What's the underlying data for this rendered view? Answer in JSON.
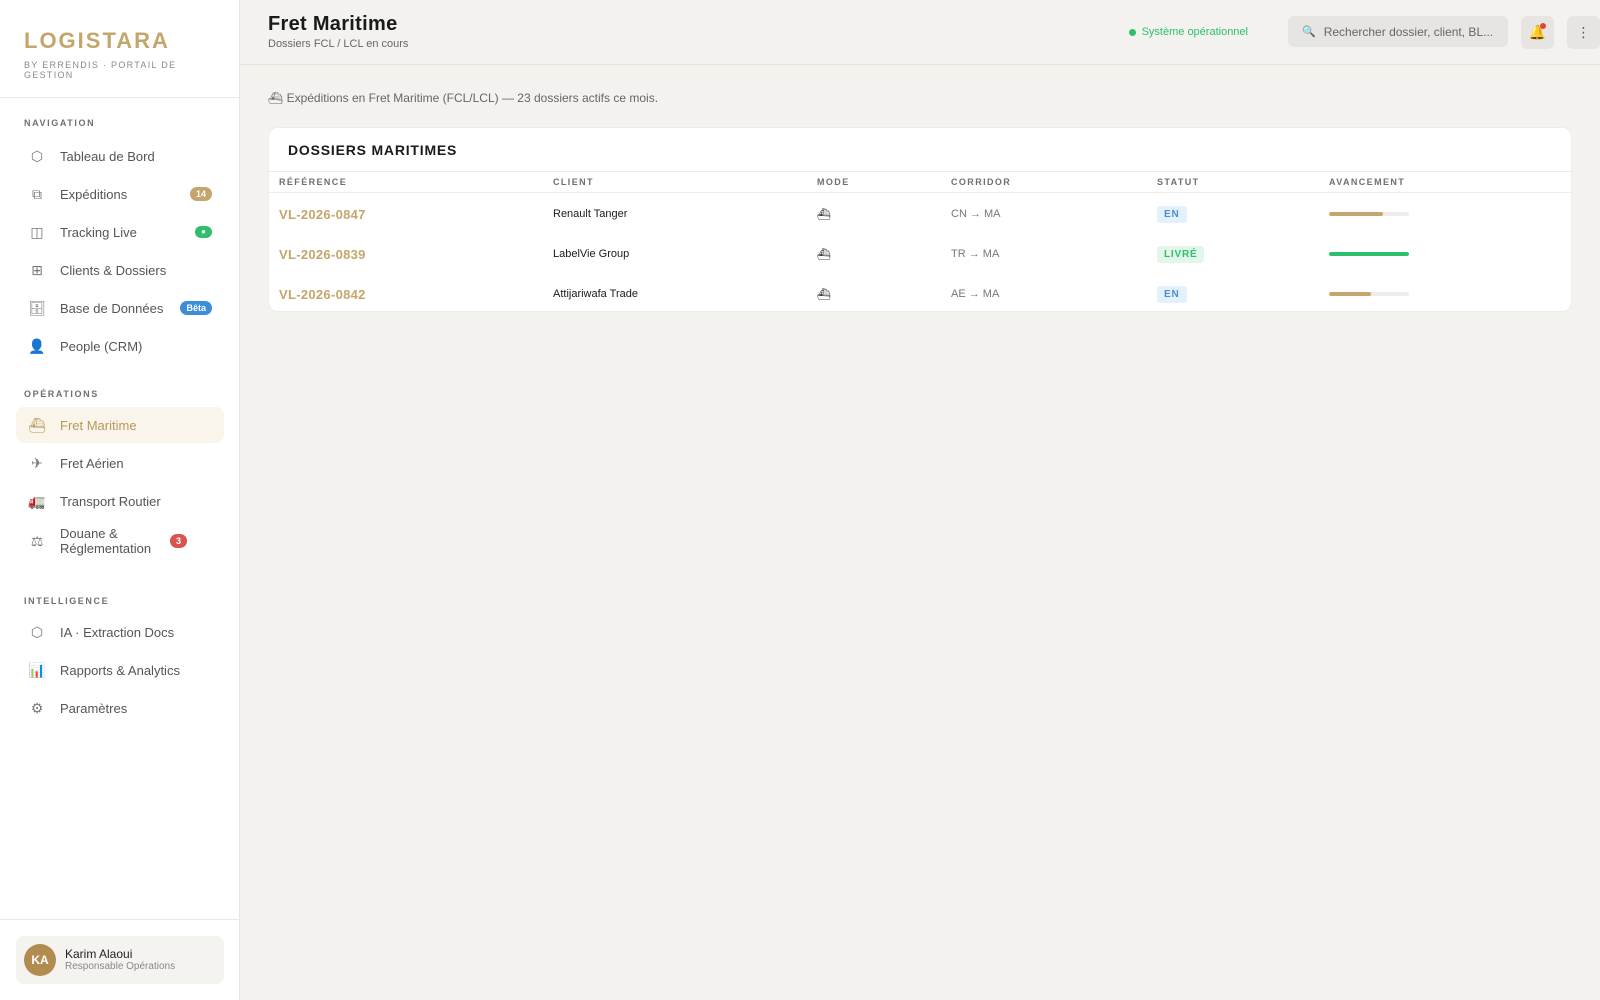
{
  "brand": {
    "name": "LOGISTARA",
    "subtitle": "BY ERRENDIS · PORTAIL DE GESTION"
  },
  "sidebar": {
    "sections": [
      {
        "title": "NAVIGATION",
        "items": [
          {
            "label": "Tableau de Bord",
            "icon": "dashboard-icon"
          },
          {
            "label": "Expéditions",
            "icon": "shipments-icon",
            "badge": "14"
          },
          {
            "label": "Tracking Live",
            "icon": "tracking-icon",
            "badge": "●"
          },
          {
            "label": "Clients & Dossiers",
            "icon": "clients-icon"
          },
          {
            "label": "Base de Données",
            "icon": "database-icon",
            "badge": "Bêta"
          },
          {
            "label": "People (CRM)",
            "icon": "people-icon"
          }
        ]
      },
      {
        "title": "OPÉRATIONS",
        "items": [
          {
            "label": "Fret Maritime",
            "icon": "ship-icon",
            "active": true
          },
          {
            "label": "Fret Aérien",
            "icon": "plane-icon"
          },
          {
            "label": "Transport Routier",
            "icon": "truck-icon"
          },
          {
            "label": "Douane & Réglementation",
            "icon": "scale-icon",
            "badge": "3"
          }
        ]
      },
      {
        "title": "INTELLIGENCE",
        "items": [
          {
            "label": "IA · Extraction Docs",
            "icon": "ai-icon"
          },
          {
            "label": "Rapports & Analytics",
            "icon": "chart-icon"
          },
          {
            "label": "Paramètres",
            "icon": "gear-icon"
          }
        ]
      }
    ],
    "user": {
      "initials": "KA",
      "name": "Karim Alaoui",
      "role": "Responsable Opérations"
    }
  },
  "header": {
    "title": "Fret Maritime",
    "subtitle": "Dossiers FCL / LCL en cours",
    "status": "Système opérationnel",
    "search_placeholder": "Rechercher dossier, client, BL..."
  },
  "main": {
    "intro": "⛴ Expéditions en Fret Maritime (FCL/LCL) — 23 dossiers actifs ce mois.",
    "card_title": "DOSSIERS MARITIMES",
    "columns": [
      "RÉFÉRENCE",
      "CLIENT",
      "MODE",
      "CORRIDOR",
      "STATUT",
      "AVANCEMENT"
    ],
    "rows": [
      {
        "ref": "VL-2026-0847",
        "client": "Renault Tanger",
        "mode": "⛴",
        "corridor": "CN → MA",
        "status": "EN",
        "progress": 0.68
      },
      {
        "ref": "VL-2026-0839",
        "client": "LabelVie Group",
        "mode": "⛴",
        "corridor": "TR → MA",
        "status": "LIVRÉ",
        "progress": 1.0
      },
      {
        "ref": "VL-2026-0842",
        "client": "Attijariwafa Trade",
        "mode": "⛴",
        "corridor": "AE → MA",
        "status": "EN",
        "progress": 0.53
      }
    ]
  },
  "colors": {
    "accent": "#c4a56b",
    "success": "#2fbf6b",
    "info": "#4a90cf",
    "danger": "#d9534f"
  }
}
